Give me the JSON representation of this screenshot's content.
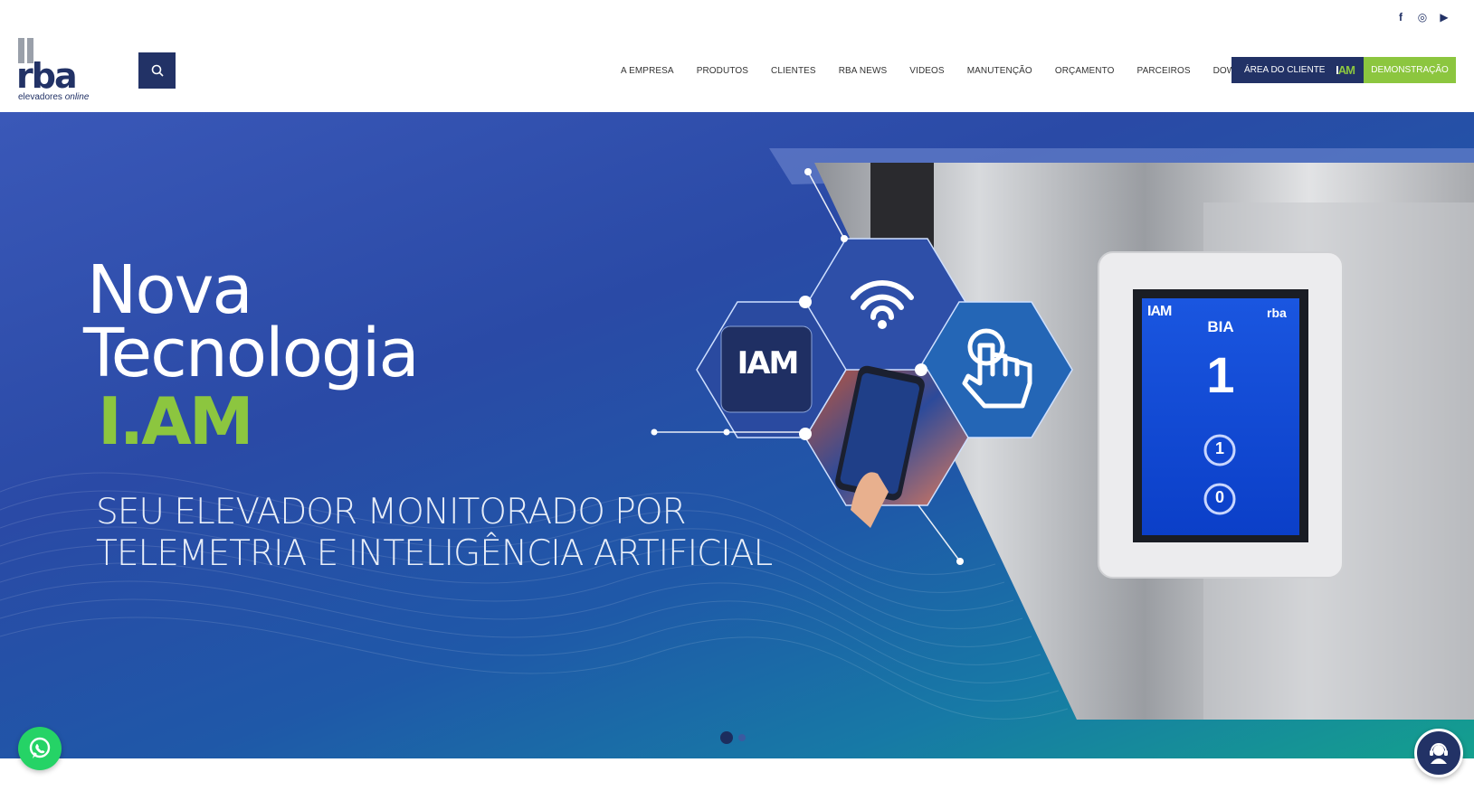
{
  "header": {
    "social": {
      "facebook": "f",
      "instagram": "◎",
      "youtube": "▶"
    },
    "logo": {
      "word": "rba",
      "sub_prefix": "elevadores",
      "sub_suffix": "online"
    },
    "nav": [
      {
        "label": "A EMPRESA"
      },
      {
        "label": "PRODUTOS"
      },
      {
        "label": "CLIENTES"
      },
      {
        "label": "RBA NEWS"
      },
      {
        "label": "VIDEOS"
      },
      {
        "label": "MANUTENÇÃO"
      },
      {
        "label": "ORÇAMENTO"
      },
      {
        "label": "PARCEIROS"
      },
      {
        "label": "DOWNLOADS"
      }
    ],
    "client_area_label": "ÁREA DO CLIENTE",
    "client_area_badge_a": "I",
    "client_area_badge_b": "AM",
    "demo_label": "DEMONSTRAÇÃO"
  },
  "hero": {
    "line1": "Nova",
    "line2": "Tecnologia",
    "line3": "I.AM",
    "subtitle1": "SEU ELEVADOR MONITORADO POR",
    "subtitle2": "TELEMETRIA E INTELIGÊNCIA ARTIFICIAL",
    "iam_tile_text": "IAM",
    "panel": {
      "logo_left": "IAM",
      "logo_right": "rba",
      "name": "BIA",
      "floor": "1",
      "buttons": [
        "1",
        "0"
      ]
    }
  },
  "colors": {
    "brand_navy": "#223266",
    "brand_green": "#8cc63f",
    "whatsapp": "#25d366"
  },
  "icons": {
    "search": "search-icon",
    "whatsapp": "whatsapp-icon",
    "support": "support-agent-icon"
  }
}
